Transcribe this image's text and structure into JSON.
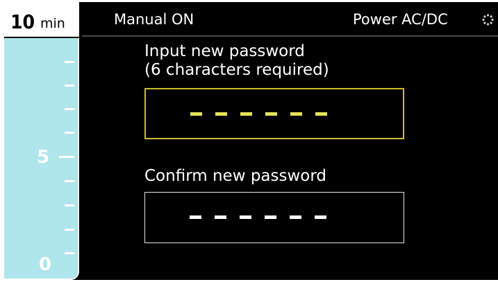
{
  "timer": {
    "max_value": "10",
    "unit": "min",
    "mid_value": "5",
    "min_value": "0"
  },
  "status_bar": {
    "mode": "Manual ON",
    "power": "Power AC/DC",
    "power_icon": "spinner-icon"
  },
  "password_form": {
    "new_password_prompt_line1": "Input new password",
    "new_password_prompt_line2": "(6 characters required)",
    "new_password_length": 6,
    "confirm_password_prompt": "Confirm new password",
    "confirm_password_length": 6,
    "active_field": "new_password"
  },
  "colors": {
    "background": "#000000",
    "gauge_fill": "#aee6ec",
    "active_field_border": "#c9c02a",
    "active_field_dash": "#e5e35a",
    "inactive_field_border": "#e6e6e6"
  }
}
